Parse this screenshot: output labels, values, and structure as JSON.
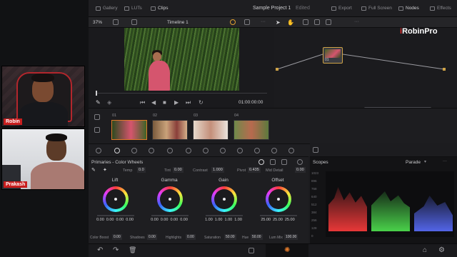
{
  "participants": [
    {
      "name": "Robin"
    },
    {
      "name": "Prakash"
    }
  ],
  "topbar": {
    "gallery": "Gallery",
    "luts": "LUTs",
    "clips": "Clips",
    "project_title": "Sample Project 1",
    "project_state": "Edited",
    "export": "Export",
    "full_screen": "Full Screen",
    "nodes": "Nodes",
    "effects": "Effects"
  },
  "viewer": {
    "zoom": "37%",
    "timeline_name": "Timeline 1",
    "timecode": "01:00:00:00"
  },
  "node_graph": {
    "node_label": "01"
  },
  "clips": [
    {
      "number": "01"
    },
    {
      "number": "02"
    },
    {
      "number": "03"
    },
    {
      "number": "04"
    }
  ],
  "primaries": {
    "title": "Primaries - Color Wheels",
    "params_top": [
      {
        "label": "Temp",
        "value": "0.0"
      },
      {
        "label": "Tint",
        "value": "0.00"
      },
      {
        "label": "Contrast",
        "value": "1.000"
      },
      {
        "label": "Pivot",
        "value": "0.435"
      },
      {
        "label": "Mid Detail",
        "value": "0.00"
      }
    ],
    "wheels": [
      {
        "name": "Lift",
        "values": [
          "0.00",
          "0.00",
          "0.00",
          "0.00"
        ]
      },
      {
        "name": "Gamma",
        "values": [
          "0.00",
          "0.00",
          "0.00",
          "0.00"
        ]
      },
      {
        "name": "Gain",
        "values": [
          "1.00",
          "1.00",
          "1.00",
          "1.00"
        ]
      },
      {
        "name": "Offset",
        "values": [
          "25.00",
          "25.00",
          "25.00"
        ]
      }
    ],
    "params_bottom": [
      {
        "label": "Color Boost",
        "value": "0.00"
      },
      {
        "label": "Shadows",
        "value": "0.00"
      },
      {
        "label": "Highlights",
        "value": "0.00"
      },
      {
        "label": "Saturation",
        "value": "50.00"
      },
      {
        "label": "Hue",
        "value": "50.00"
      },
      {
        "label": "Lum Mix",
        "value": "100.00"
      }
    ]
  },
  "scopes": {
    "title": "Scopes",
    "mode": "Parade",
    "axis": [
      "1023",
      "896",
      "768",
      "640",
      "512",
      "384",
      "256",
      "128",
      "0"
    ]
  },
  "watermark": {
    "prefix": "i",
    "text": "RobinPro"
  }
}
